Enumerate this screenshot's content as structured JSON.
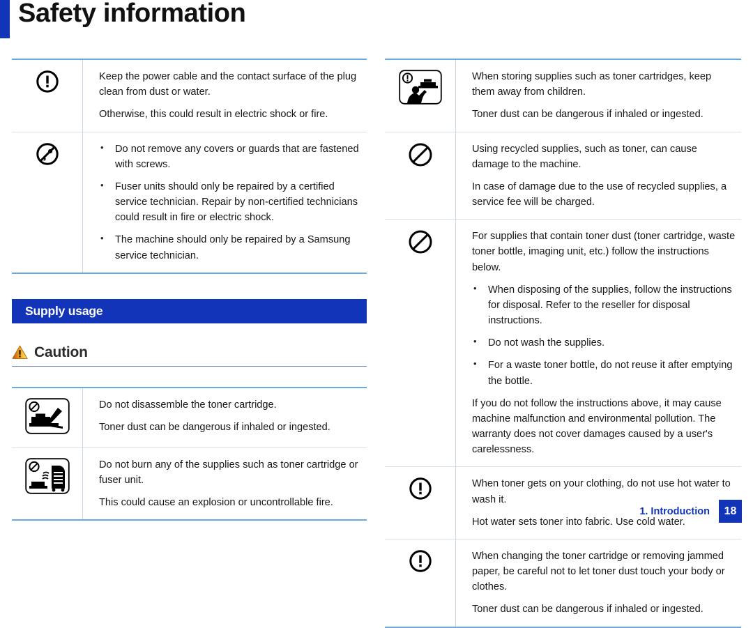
{
  "page": {
    "title": "Safety information"
  },
  "left_column": {
    "table_top": {
      "rows": [
        {
          "icon": "exclamation-circle-icon",
          "paragraphs": [
            "Keep the power cable and the contact surface of the plug clean from dust or water.",
            "Otherwise, this could result in electric shock or fire."
          ],
          "bullets": []
        },
        {
          "icon": "no-disassemble-wrench-icon",
          "paragraphs": [],
          "bullets": [
            "Do not remove any covers or guards that are fastened with screws.",
            "Fuser units should only be repaired by a certified service technician. Repair by non-certified technicians could result in fire or electric shock.",
            "The machine should only be repaired by a Samsung service technician."
          ]
        }
      ]
    },
    "section_banner": {
      "label": "Supply usage"
    },
    "caution_heading": {
      "label": "Caution",
      "icon": "warning-triangle-icon"
    },
    "table_bottom": {
      "rows": [
        {
          "icon": "no-disassemble-toner-cartridge-icon",
          "paragraphs": [
            "Do not disassemble the toner cartridge.",
            "Toner dust can be dangerous if inhaled or ingested."
          ],
          "bullets": []
        },
        {
          "icon": "no-burn-supplies-icon",
          "paragraphs": [
            "Do not burn any of the supplies such as toner cartridge or fuser unit.",
            "This could cause an explosion or uncontrollable fire."
          ],
          "bullets": []
        }
      ]
    }
  },
  "right_column": {
    "table": {
      "rows": [
        {
          "icon": "keep-away-from-children-icon",
          "paragraphs": [
            "When storing supplies such as toner cartridges, keep them away from children.",
            "Toner dust can be dangerous if inhaled or ingested."
          ],
          "bullets": []
        },
        {
          "icon": "prohibition-icon",
          "paragraphs": [
            "Using recycled supplies, such as toner, can cause damage to the machine.",
            "In case of damage due to the use of recycled supplies, a service fee will be charged."
          ],
          "bullets": []
        },
        {
          "icon": "prohibition-icon",
          "paragraphs": [
            "For supplies that contain toner dust (toner cartridge, waste toner bottle, imaging unit, etc.) follow the instructions below."
          ],
          "bullets": [
            "When disposing of the supplies, follow the instructions for disposal. Refer to the reseller for disposal instructions.",
            "Do not wash the supplies.",
            "For a waste toner bottle, do not reuse it after emptying the bottle."
          ],
          "paragraphs_after": [
            "If you do not follow the instructions above, it may cause machine malfunction and environmental pollution. The warranty does not cover damages caused by a user's carelessness."
          ]
        },
        {
          "icon": "exclamation-circle-icon",
          "paragraphs": [
            "When toner gets on your clothing, do not use hot water to wash it.",
            "Hot water sets toner into fabric. Use cold water."
          ],
          "bullets": []
        },
        {
          "icon": "exclamation-circle-icon",
          "paragraphs": [
            "When changing the toner cartridge or removing jammed paper, be careful not to let toner dust touch your body or clothes.",
            "Toner dust can be dangerous if inhaled or ingested."
          ],
          "bullets": []
        }
      ]
    }
  },
  "footer": {
    "chapter": "1. Introduction",
    "page_number": "18"
  },
  "colors": {
    "brand_blue": "#1134b8",
    "rule_blue": "#6aa9dd",
    "divider": "#c9d6e4"
  }
}
